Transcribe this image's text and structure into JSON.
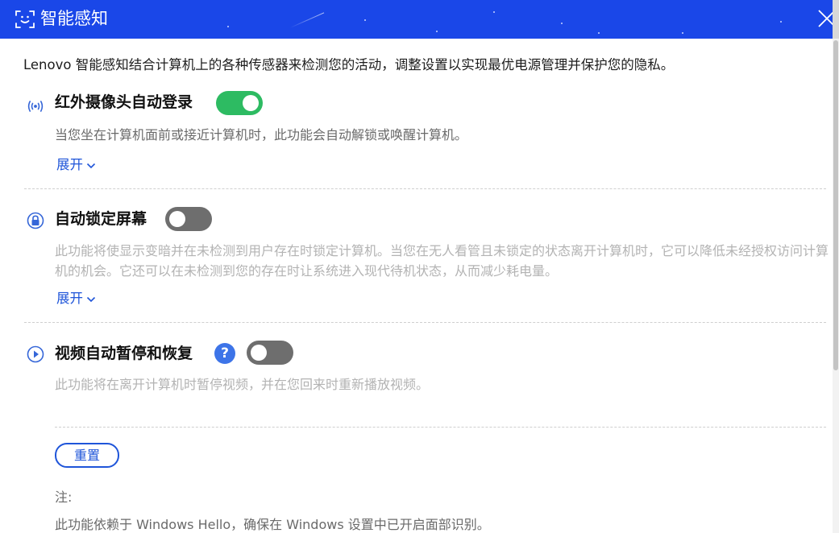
{
  "window": {
    "title": "智能感知",
    "colors": {
      "titlebar": "#1a47e8",
      "accent": "#1f55d9",
      "toggle_on": "#2dbb62",
      "toggle_off": "#6e6e6e"
    },
    "icons": {
      "title": "face-scan-icon",
      "close": "close-icon"
    }
  },
  "intro": "Lenovo 智能感知结合计算机上的各种传感器来检测您的活动，调整设置以实现最优电源管理并保护您的隐私。",
  "features": [
    {
      "icon": "infrared-signal-icon",
      "title": "红外摄像头自动登录",
      "enabled": true,
      "description": "当您坐在计算机面前或接近计算机时，此功能会自动解锁或唤醒计算机。",
      "expand_label": "展开"
    },
    {
      "icon": "auto-lock-icon",
      "title": "自动锁定屏幕",
      "enabled": false,
      "description": "此功能将使显示变暗并在未检测到用户存在时锁定计算机。当您在无人看管且未锁定的状态离开计算机时，它可以降低未经授权访问计算机的机会。它还可以在未检测到您的存在时让系统进入现代待机状态，从而减少耗电量。",
      "expand_label": "展开"
    },
    {
      "icon": "play-circle-icon",
      "title": "视频自动暂停和恢复",
      "enabled": false,
      "help": "?",
      "description": "此功能将在离开计算机时暂停视频，并在您回来时重新播放视频。"
    }
  ],
  "reset_label": "重置",
  "note": {
    "label": "注:",
    "text": "此功能依赖于 Windows Hello，确保在 Windows 设置中已开启面部识别。"
  }
}
